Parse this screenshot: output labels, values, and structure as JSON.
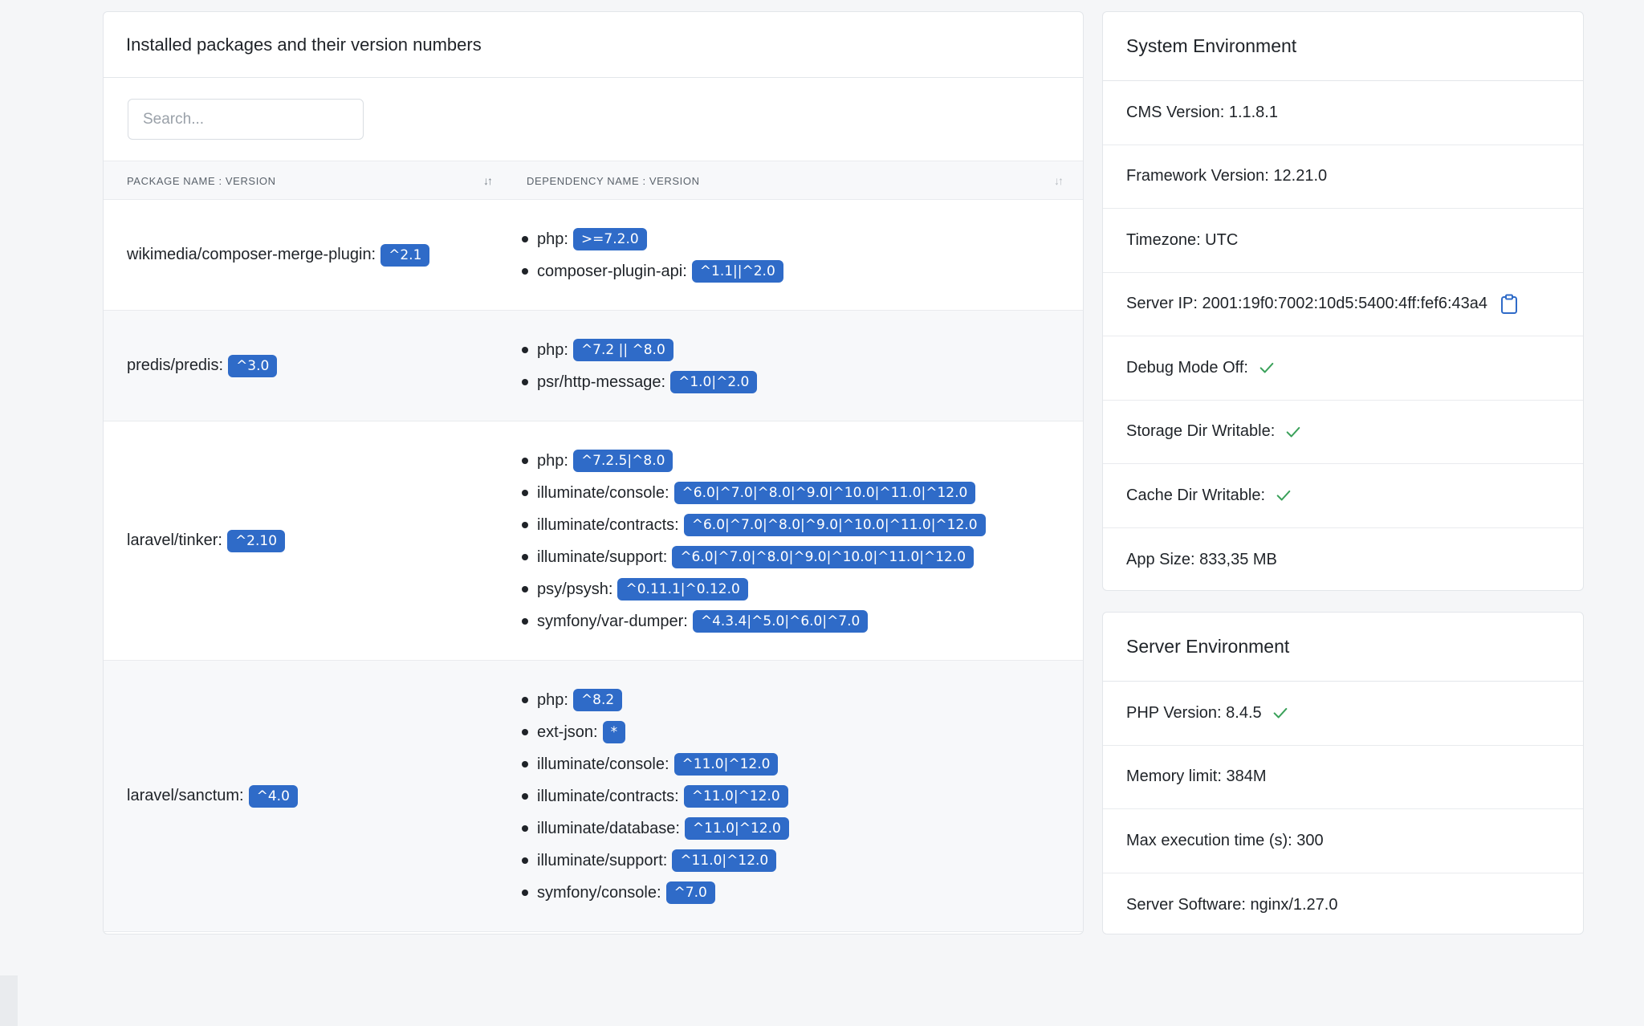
{
  "packages": {
    "title": "Installed packages and their version numbers",
    "search_placeholder": "Search...",
    "columns": {
      "package": "PACKAGE NAME : VERSION",
      "dependency": "DEPENDENCY NAME : VERSION",
      "package_sort_icon": "↓↑",
      "dependency_sort_icon": "↓↑"
    },
    "rows": [
      {
        "name": "wikimedia/composer-merge-plugin:",
        "version": "^2.1",
        "deps": [
          {
            "name": "php:",
            "version": ">=7.2.0"
          },
          {
            "name": "composer-plugin-api:",
            "version": "^1.1||^2.0"
          }
        ]
      },
      {
        "name": "predis/predis:",
        "version": "^3.0",
        "deps": [
          {
            "name": "php:",
            "version": "^7.2 || ^8.0"
          },
          {
            "name": "psr/http-message:",
            "version": "^1.0|^2.0"
          }
        ]
      },
      {
        "name": "laravel/tinker:",
        "version": "^2.10",
        "deps": [
          {
            "name": "php:",
            "version": "^7.2.5|^8.0"
          },
          {
            "name": "illuminate/console:",
            "version": "^6.0|^7.0|^8.0|^9.0|^10.0|^11.0|^12.0"
          },
          {
            "name": "illuminate/contracts:",
            "version": "^6.0|^7.0|^8.0|^9.0|^10.0|^11.0|^12.0"
          },
          {
            "name": "illuminate/support:",
            "version": "^6.0|^7.0|^8.0|^9.0|^10.0|^11.0|^12.0"
          },
          {
            "name": "psy/psysh:",
            "version": "^0.11.1|^0.12.0"
          },
          {
            "name": "symfony/var-dumper:",
            "version": "^4.3.4|^5.0|^6.0|^7.0"
          }
        ]
      },
      {
        "name": "laravel/sanctum:",
        "version": "^4.0",
        "deps": [
          {
            "name": "php:",
            "version": "^8.2"
          },
          {
            "name": "ext-json:",
            "version": "*"
          },
          {
            "name": "illuminate/console:",
            "version": "^11.0|^12.0"
          },
          {
            "name": "illuminate/contracts:",
            "version": "^11.0|^12.0"
          },
          {
            "name": "illuminate/database:",
            "version": "^11.0|^12.0"
          },
          {
            "name": "illuminate/support:",
            "version": "^11.0|^12.0"
          },
          {
            "name": "symfony/console:",
            "version": "^7.0"
          }
        ]
      }
    ]
  },
  "system_env": {
    "title": "System Environment",
    "items": [
      {
        "key": "cms-version",
        "text": "CMS Version: 1.1.8.1",
        "icon": ""
      },
      {
        "key": "framework-version",
        "text": "Framework Version: 12.21.0",
        "icon": ""
      },
      {
        "key": "timezone",
        "text": "Timezone: UTC",
        "icon": ""
      },
      {
        "key": "server-ip",
        "text": "Server IP: 2001:19f0:7002:10d5:5400:4ff:fef6:43a4",
        "icon": "clipboard-icon"
      },
      {
        "key": "debug-mode",
        "text": "Debug Mode Off:",
        "icon": "check-icon"
      },
      {
        "key": "storage-dir",
        "text": "Storage Dir Writable:",
        "icon": "check-icon"
      },
      {
        "key": "cache-dir",
        "text": "Cache Dir Writable:",
        "icon": "check-icon"
      },
      {
        "key": "app-size",
        "text": "App Size: 833,35 MB",
        "icon": ""
      }
    ]
  },
  "server_env": {
    "title": "Server Environment",
    "items": [
      {
        "key": "php-version",
        "text": "PHP Version: 8.4.5",
        "icon": "check-icon"
      },
      {
        "key": "memory-limit",
        "text": "Memory limit: 384M",
        "icon": ""
      },
      {
        "key": "max-execution-time",
        "text": "Max execution time (s): 300",
        "icon": ""
      },
      {
        "key": "server-software",
        "text": "Server Software: nginx/1.27.0",
        "icon": ""
      }
    ]
  },
  "colors": {
    "badge": "#2f6bc8",
    "check": "#3aa15a",
    "clipboard": "#2f6bc8"
  }
}
